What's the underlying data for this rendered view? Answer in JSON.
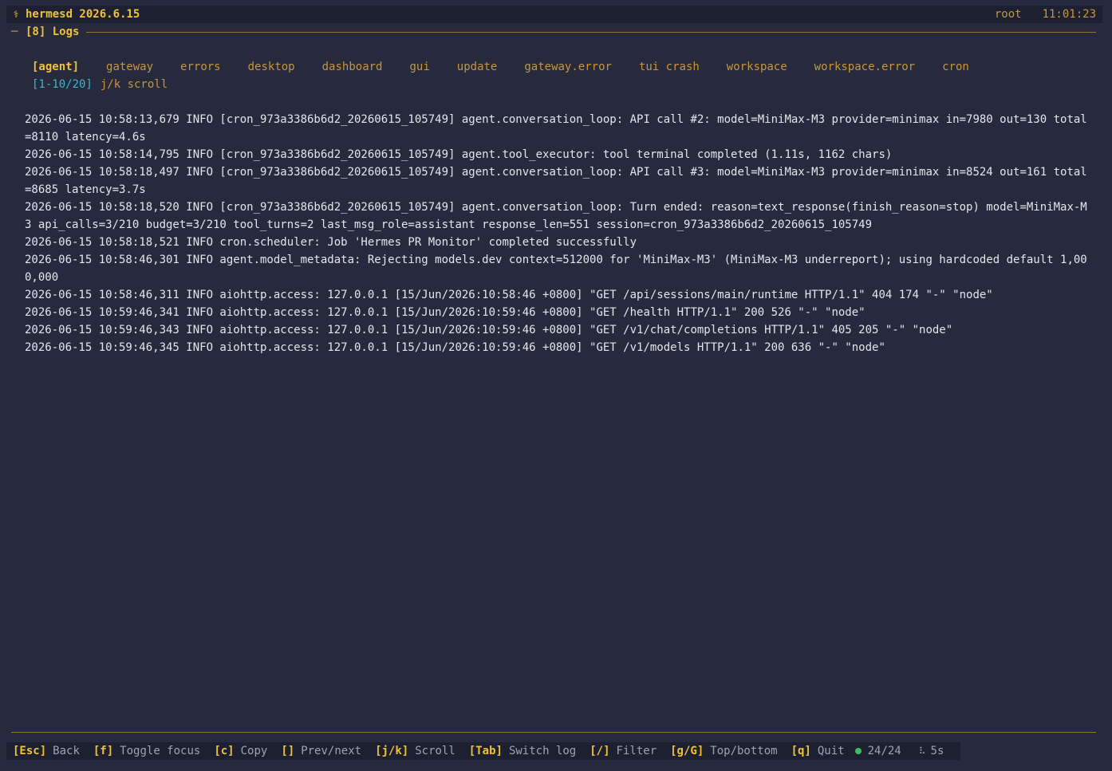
{
  "titlebar": {
    "logo_glyph": "⚕",
    "app_name": "hermesd 2026.6.15",
    "user": "root",
    "time": "11:01:23"
  },
  "panel": {
    "dash": "─",
    "title": "[8] Logs"
  },
  "tabs": [
    {
      "label": "[agent]",
      "active": true
    },
    {
      "label": "gateway",
      "active": false
    },
    {
      "label": "errors",
      "active": false
    },
    {
      "label": "desktop",
      "active": false
    },
    {
      "label": "dashboard",
      "active": false
    },
    {
      "label": "gui",
      "active": false
    },
    {
      "label": "update",
      "active": false
    },
    {
      "label": "gateway.error",
      "active": false
    },
    {
      "label": "tui crash",
      "active": false
    },
    {
      "label": "workspace",
      "active": false
    },
    {
      "label": "workspace.error",
      "active": false
    },
    {
      "label": "cron",
      "active": false
    }
  ],
  "subline": {
    "range": "[1-10/20]",
    "hint": "j/k scroll"
  },
  "log_lines": [
    "2026-06-15 10:58:13,679 INFO [cron_973a3386b6d2_20260615_105749] agent.conversation_loop: API call #2: model=MiniMax-M3 provider=minimax in=7980 out=130 total=8110 latency=4.6s",
    "2026-06-15 10:58:14,795 INFO [cron_973a3386b6d2_20260615_105749] agent.tool_executor: tool terminal completed (1.11s, 1162 chars)",
    "2026-06-15 10:58:18,497 INFO [cron_973a3386b6d2_20260615_105749] agent.conversation_loop: API call #3: model=MiniMax-M3 provider=minimax in=8524 out=161 total=8685 latency=3.7s",
    "2026-06-15 10:58:18,520 INFO [cron_973a3386b6d2_20260615_105749] agent.conversation_loop: Turn ended: reason=text_response(finish_reason=stop) model=MiniMax-M3 api_calls=3/210 budget=3/210 tool_turns=2 last_msg_role=assistant response_len=551 session=cron_973a3386b6d2_20260615_105749",
    "2026-06-15 10:58:18,521 INFO cron.scheduler: Job 'Hermes PR Monitor' completed successfully",
    "2026-06-15 10:58:46,301 INFO agent.model_metadata: Rejecting models.dev context=512000 for 'MiniMax-M3' (MiniMax-M3 underreport); using hardcoded default 1,000,000",
    "2026-06-15 10:58:46,311 INFO aiohttp.access: 127.0.0.1 [15/Jun/2026:10:58:46 +0800] \"GET /api/sessions/main/runtime HTTP/1.1\" 404 174 \"-\" \"node\"",
    "2026-06-15 10:59:46,341 INFO aiohttp.access: 127.0.0.1 [15/Jun/2026:10:59:46 +0800] \"GET /health HTTP/1.1\" 200 526 \"-\" \"node\"",
    "2026-06-15 10:59:46,343 INFO aiohttp.access: 127.0.0.1 [15/Jun/2026:10:59:46 +0800] \"GET /v1/chat/completions HTTP/1.1\" 405 205 \"-\" \"node\"",
    "2026-06-15 10:59:46,345 INFO aiohttp.access: 127.0.0.1 [15/Jun/2026:10:59:46 +0800] \"GET /v1/models HTTP/1.1\" 200 636 \"-\" \"node\""
  ],
  "footer": {
    "shortcuts": [
      {
        "key": "[Esc]",
        "label": "Back"
      },
      {
        "key": "[f]",
        "label": "Toggle focus"
      },
      {
        "key": "[c]",
        "label": "Copy"
      },
      {
        "key": "[]",
        "label": "Prev/next"
      },
      {
        "key": "[j/k]",
        "label": "Scroll"
      },
      {
        "key": "[Tab]",
        "label": "Switch log"
      },
      {
        "key": "[/]",
        "label": "Filter"
      },
      {
        "key": "[g/G]",
        "label": "Top/bottom"
      },
      {
        "key": "[q]",
        "label": "Quit"
      }
    ],
    "status_count": "24/24",
    "spinner_glyph": "⠧",
    "interval": "5s"
  },
  "colors": {
    "background": "#262a3c",
    "accent": "#f0c23a",
    "muted_accent": "#c9963a",
    "cyan": "#3fb6c8",
    "status_ok": "#3dbd5c"
  }
}
